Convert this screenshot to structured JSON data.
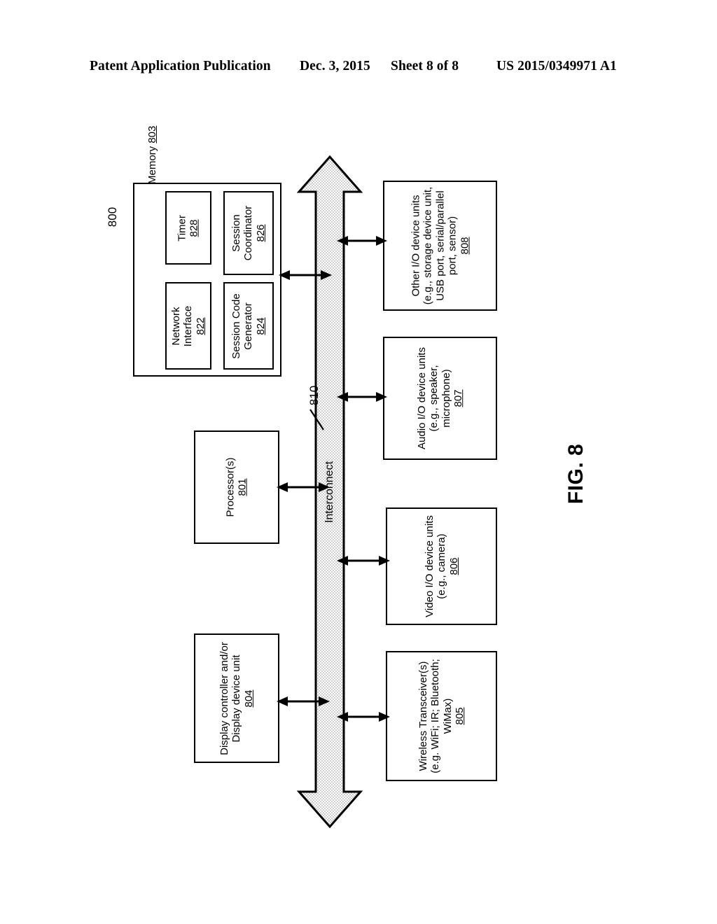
{
  "header": {
    "title": "Patent Application Publication",
    "date": "Dec. 3, 2015",
    "sheet": "Sheet 8 of 8",
    "publication_number": "US 2015/0349971 A1"
  },
  "figure": {
    "label": "FIG. 8",
    "system_ref": "800",
    "interconnect": {
      "label": "Interconnect",
      "ref": "810"
    }
  },
  "blocks": {
    "memory": {
      "label": "Memory",
      "ref": "803",
      "submodules": [
        {
          "name": "timer",
          "label": "Timer",
          "ref": "828"
        },
        {
          "name": "session-coordinator",
          "label": "Session\nCoordinator",
          "line1": "Session",
          "line2": "Coordinator",
          "ref": "826"
        },
        {
          "name": "network-interface",
          "label": "Network\nInterface",
          "line1": "Network",
          "line2": "Interface",
          "ref": "822"
        },
        {
          "name": "session-code-generator",
          "label": "Session Code\nGenerator",
          "line1": "Session Code",
          "line2": "Generator",
          "ref": "824"
        }
      ]
    },
    "processor": {
      "line1": "Processor(s)",
      "ref": "801"
    },
    "display_controller": {
      "line1": "Display controller and/or",
      "line2": "Display device unit",
      "ref": "804"
    },
    "other_io": {
      "line1": "Other I/O device units",
      "line2": "(e.g., storage device unit,",
      "line3": "USB port, serial/parallel",
      "line4": "port, sensor)",
      "ref": "808"
    },
    "audio_io": {
      "line1": "Audio I/O device units",
      "line2": "(e.g., speaker,",
      "line3": "microphone)",
      "ref": "807"
    },
    "video_io": {
      "line1": "Video I/O device units",
      "line2": "(e.g., camera)",
      "ref": "806"
    },
    "wireless": {
      "line1": "Wireless Transceiver(s)",
      "line2": "(e.g. WiFi; IR; Bluetooth;",
      "line3": "WiMax)",
      "ref": "805"
    }
  },
  "colors": {
    "ink": "#000000",
    "paper": "#ffffff",
    "interconnect_fill": "#dcdcdc"
  }
}
